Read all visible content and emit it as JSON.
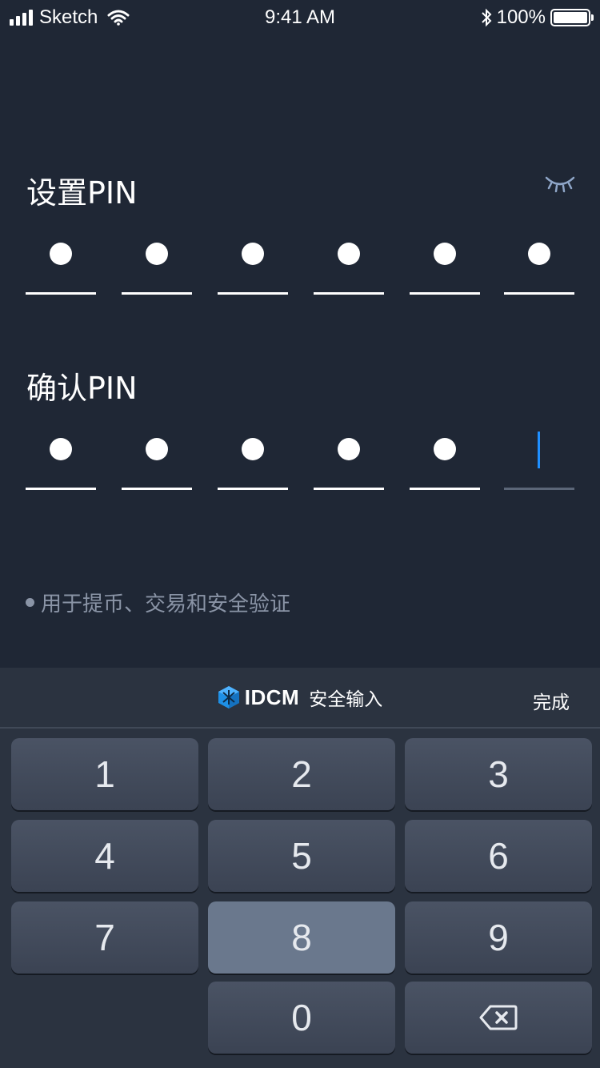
{
  "status_bar": {
    "carrier": "Sketch",
    "time": "9:41 AM",
    "battery_percent": "100%",
    "battery_level": 1.0,
    "icons": [
      "signal-icon",
      "wifi-icon",
      "bluetooth-icon",
      "battery-icon"
    ]
  },
  "set_pin": {
    "title": "设置PIN",
    "filled_digits": 6,
    "total_digits": 6,
    "visibility_icon": "eye-closed-icon"
  },
  "confirm_pin": {
    "title": "确认PIN",
    "filled_digits": 5,
    "total_digits": 6
  },
  "hint": "用于提币、交易和安全验证",
  "keyboard": {
    "brand": "IDCM",
    "subtitle": "安全输入",
    "done_label": "完成",
    "keys": [
      "1",
      "2",
      "3",
      "4",
      "5",
      "6",
      "7",
      "8",
      "9",
      "0"
    ],
    "pressed_key": "8",
    "delete_icon": "backspace-icon"
  },
  "colors": {
    "background": "#1f2735",
    "keyboard_bg": "#2b3340",
    "cursor": "#1f8fff",
    "hint": "#8a94a6"
  }
}
